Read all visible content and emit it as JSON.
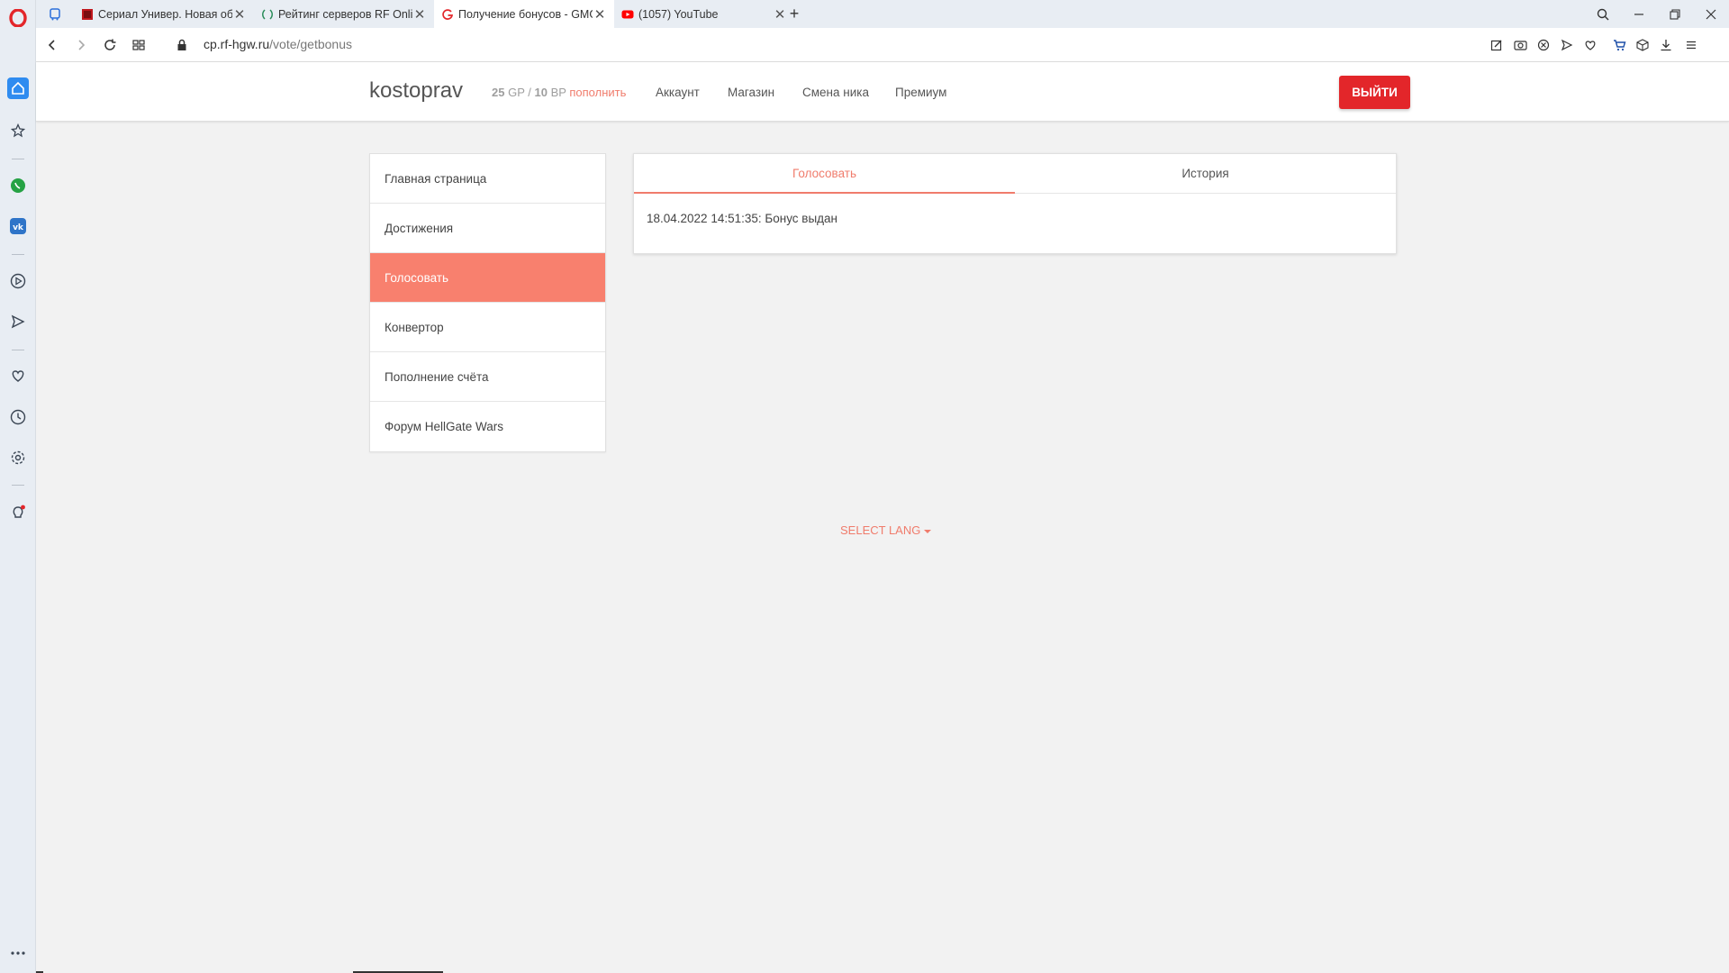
{
  "browser": {
    "tabs": [
      {
        "title": "",
        "icon": "bus-icon",
        "color": "#2a6fdb"
      },
      {
        "title": "Сериал Универ. Новая общага",
        "icon": "film-icon",
        "color": "#c0171d"
      },
      {
        "title": "Рейтинг серверов RF Online",
        "icon": "rating-icon",
        "color": "#2a8c5a"
      },
      {
        "title": "Получение бонусов - GMG",
        "icon": "g-icon",
        "color": "#e3262a",
        "active": true
      },
      {
        "title": "(1057) YouTube",
        "icon": "youtube-icon",
        "color": "#ff0000"
      }
    ],
    "new_tab": "+",
    "url_host": "cp.rf-hgw.ru",
    "url_path": "/vote/getbonus"
  },
  "header": {
    "brand": "kostoprav",
    "gp_value": "25",
    "gp_label": "GP",
    "sep": "/",
    "bp_value": "10",
    "bp_label": "BP",
    "topup_label": "пополнить",
    "nav": [
      "Аккаунт",
      "Магазин",
      "Смена ника",
      "Премиум"
    ],
    "logout_label": "ВЫЙТИ"
  },
  "menu": {
    "items": [
      {
        "label": "Главная страница"
      },
      {
        "label": "Достижения"
      },
      {
        "label": "Голосовать",
        "active": true
      },
      {
        "label": "Конвертор"
      },
      {
        "label": "Пополнение счёта"
      },
      {
        "label": "Форум HellGate Wars"
      }
    ]
  },
  "content": {
    "tabs": [
      "Голосовать",
      "История"
    ],
    "history_entry": "18.04.2022 14:51:35: Бонус выдан"
  },
  "footer": {
    "select_lang": "SELECT LANG"
  },
  "colors": {
    "accent": "#f8806e",
    "logout": "#e3262a"
  }
}
